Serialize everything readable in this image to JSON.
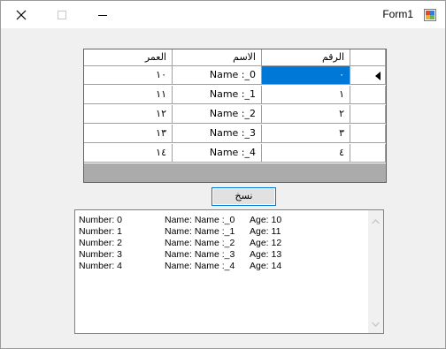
{
  "window": {
    "title": "Form1"
  },
  "grid": {
    "headers": {
      "number": "الرقم",
      "name": "الاسم",
      "age": "العمر"
    },
    "rows": [
      {
        "number": "٠",
        "name": "Name :_0",
        "age": "١٠"
      },
      {
        "number": "١",
        "name": "Name :_1",
        "age": "١١"
      },
      {
        "number": "٢",
        "name": "Name :_2",
        "age": "١٢"
      },
      {
        "number": "٣",
        "name": "Name :_3",
        "age": "١٣"
      },
      {
        "number": "٤",
        "name": "Name :_4",
        "age": "١٤"
      }
    ],
    "selected_color": "#0078d7"
  },
  "copy_button": {
    "label": "نسخ"
  },
  "list": [
    {
      "number": "Number: 0",
      "name": "Name: Name :_0",
      "age": "Age: 10"
    },
    {
      "number": "Number: 1",
      "name": "Name: Name :_1",
      "age": "Age: 11"
    },
    {
      "number": "Number: 2",
      "name": "Name: Name :_2",
      "age": "Age: 12"
    },
    {
      "number": "Number: 3",
      "name": "Name: Name :_3",
      "age": "Age: 13"
    },
    {
      "number": "Number: 4",
      "name": "Name: Name :_4",
      "age": "Age: 14"
    }
  ]
}
